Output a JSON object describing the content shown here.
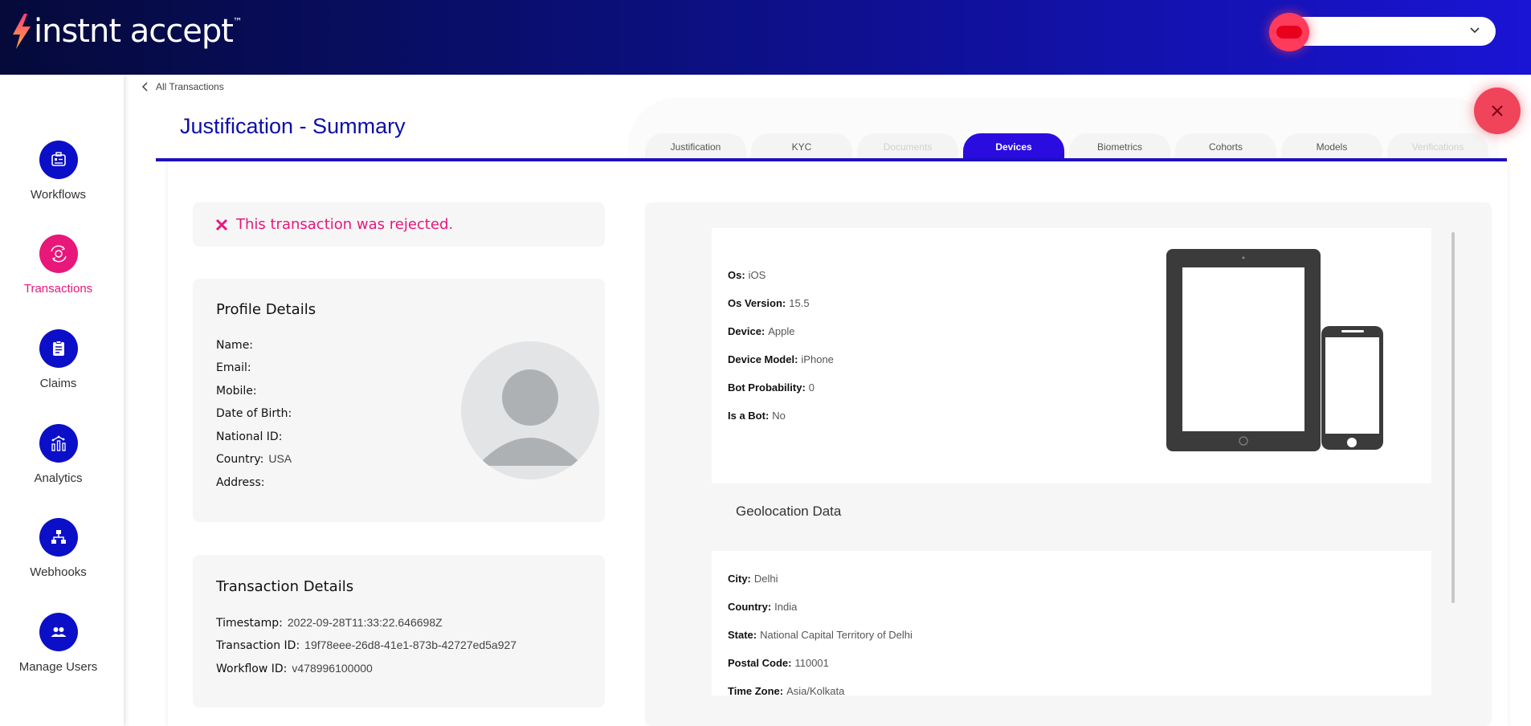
{
  "app": {
    "logo_text": "instnt accept",
    "logo_tm": "™"
  },
  "header": {
    "user_select_value": ""
  },
  "sidebar": {
    "items": [
      {
        "label": "Workflows",
        "icon": "workflow-icon",
        "active": false
      },
      {
        "label": "Transactions",
        "icon": "transactions-icon",
        "active": true
      },
      {
        "label": "Claims",
        "icon": "clipboard-icon",
        "active": false
      },
      {
        "label": "Analytics",
        "icon": "analytics-icon",
        "active": false
      },
      {
        "label": "Webhooks",
        "icon": "webhooks-icon",
        "active": false
      },
      {
        "label": "Manage Users",
        "icon": "users-icon",
        "active": false
      }
    ]
  },
  "breadcrumb": {
    "back_label": "All Transactions"
  },
  "page": {
    "title": "Justification - Summary"
  },
  "tabs": [
    {
      "label": "Justification",
      "state": "normal"
    },
    {
      "label": "KYC",
      "state": "normal"
    },
    {
      "label": "Documents",
      "state": "disabled"
    },
    {
      "label": "Devices",
      "state": "active"
    },
    {
      "label": "Biometrics",
      "state": "normal"
    },
    {
      "label": "Cohorts",
      "state": "normal"
    },
    {
      "label": "Models",
      "state": "normal"
    },
    {
      "label": "Verifications",
      "state": "disabled"
    }
  ],
  "status": {
    "message": "This transaction was rejected."
  },
  "profile": {
    "title": "Profile Details",
    "fields": [
      {
        "label": "Name:",
        "value": ""
      },
      {
        "label": "Email:",
        "value": ""
      },
      {
        "label": "Mobile:",
        "value": ""
      },
      {
        "label": "Date of Birth:",
        "value": ""
      },
      {
        "label": "National ID:",
        "value": ""
      },
      {
        "label": "Country:",
        "value": "USA"
      },
      {
        "label": "Address:",
        "value": ""
      }
    ]
  },
  "transaction": {
    "title": "Transaction Details",
    "fields": [
      {
        "label": "Timestamp:",
        "value": "2022-09-28T11:33:22.646698Z"
      },
      {
        "label": "Transaction ID:",
        "value": "19f78eee-26d8-41e1-873b-42727ed5a927"
      },
      {
        "label": "Workflow ID:",
        "value": "v478996100000"
      }
    ]
  },
  "device": {
    "fields": [
      {
        "label": "Os:",
        "value": "iOS"
      },
      {
        "label": "Os Version:",
        "value": "15.5"
      },
      {
        "label": "Device:",
        "value": "Apple"
      },
      {
        "label": "Device Model:",
        "value": "iPhone"
      },
      {
        "label": "Bot Probability:",
        "value": "0"
      },
      {
        "label": "Is a Bot:",
        "value": "No"
      }
    ]
  },
  "geolocation": {
    "heading": "Geolocation Data",
    "fields": [
      {
        "label": "City:",
        "value": "Delhi"
      },
      {
        "label": "Country:",
        "value": "India"
      },
      {
        "label": "State:",
        "value": "National Capital Territory of Delhi"
      },
      {
        "label": "Postal Code:",
        "value": "110001"
      },
      {
        "label": "Time Zone:",
        "value": "Asia/Kolkata"
      }
    ]
  },
  "colors": {
    "primary": "#0c0fc8",
    "accent": "#e8177a",
    "active_tab": "#2b0ce0",
    "close_button": "#f0445a"
  }
}
